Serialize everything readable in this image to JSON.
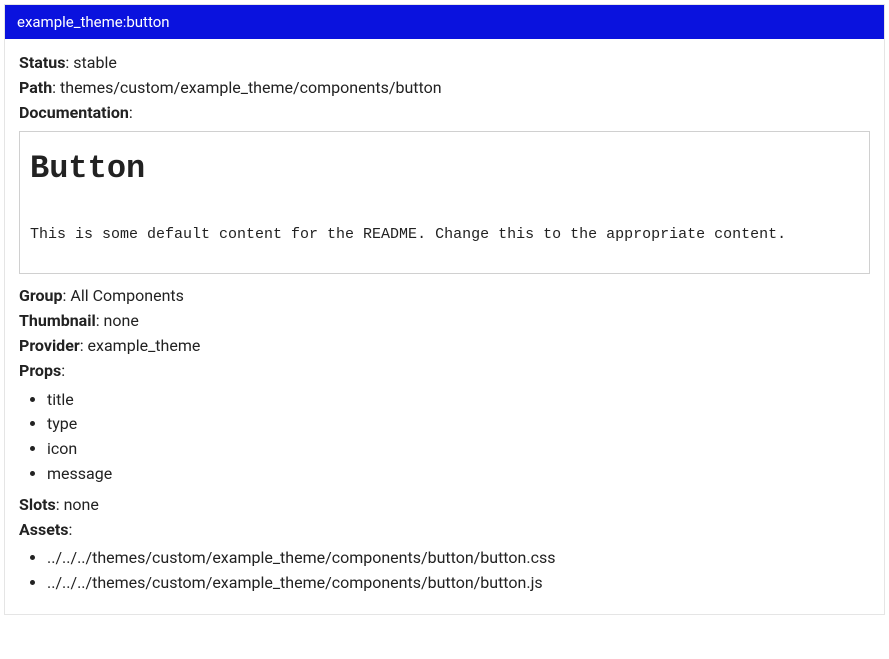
{
  "header": {
    "title": "example_theme:button"
  },
  "labels": {
    "status": "Status",
    "path": "Path",
    "documentation": "Documentation",
    "group": "Group",
    "thumbnail": "Thumbnail",
    "provider": "Provider",
    "props": "Props",
    "slots": "Slots",
    "assets": "Assets"
  },
  "values": {
    "status": "stable",
    "path": "themes/custom/example_theme/components/button",
    "group": "All Components",
    "thumbnail": "none",
    "provider": "example_theme",
    "slots": "none"
  },
  "documentation": {
    "title": "Button",
    "body": "This is some default content for the README. Change this to the appropriate content."
  },
  "props": [
    "title",
    "type",
    "icon",
    "message"
  ],
  "assets": [
    "../../../themes/custom/example_theme/components/button/button.css",
    "../../../themes/custom/example_theme/components/button/button.js"
  ]
}
